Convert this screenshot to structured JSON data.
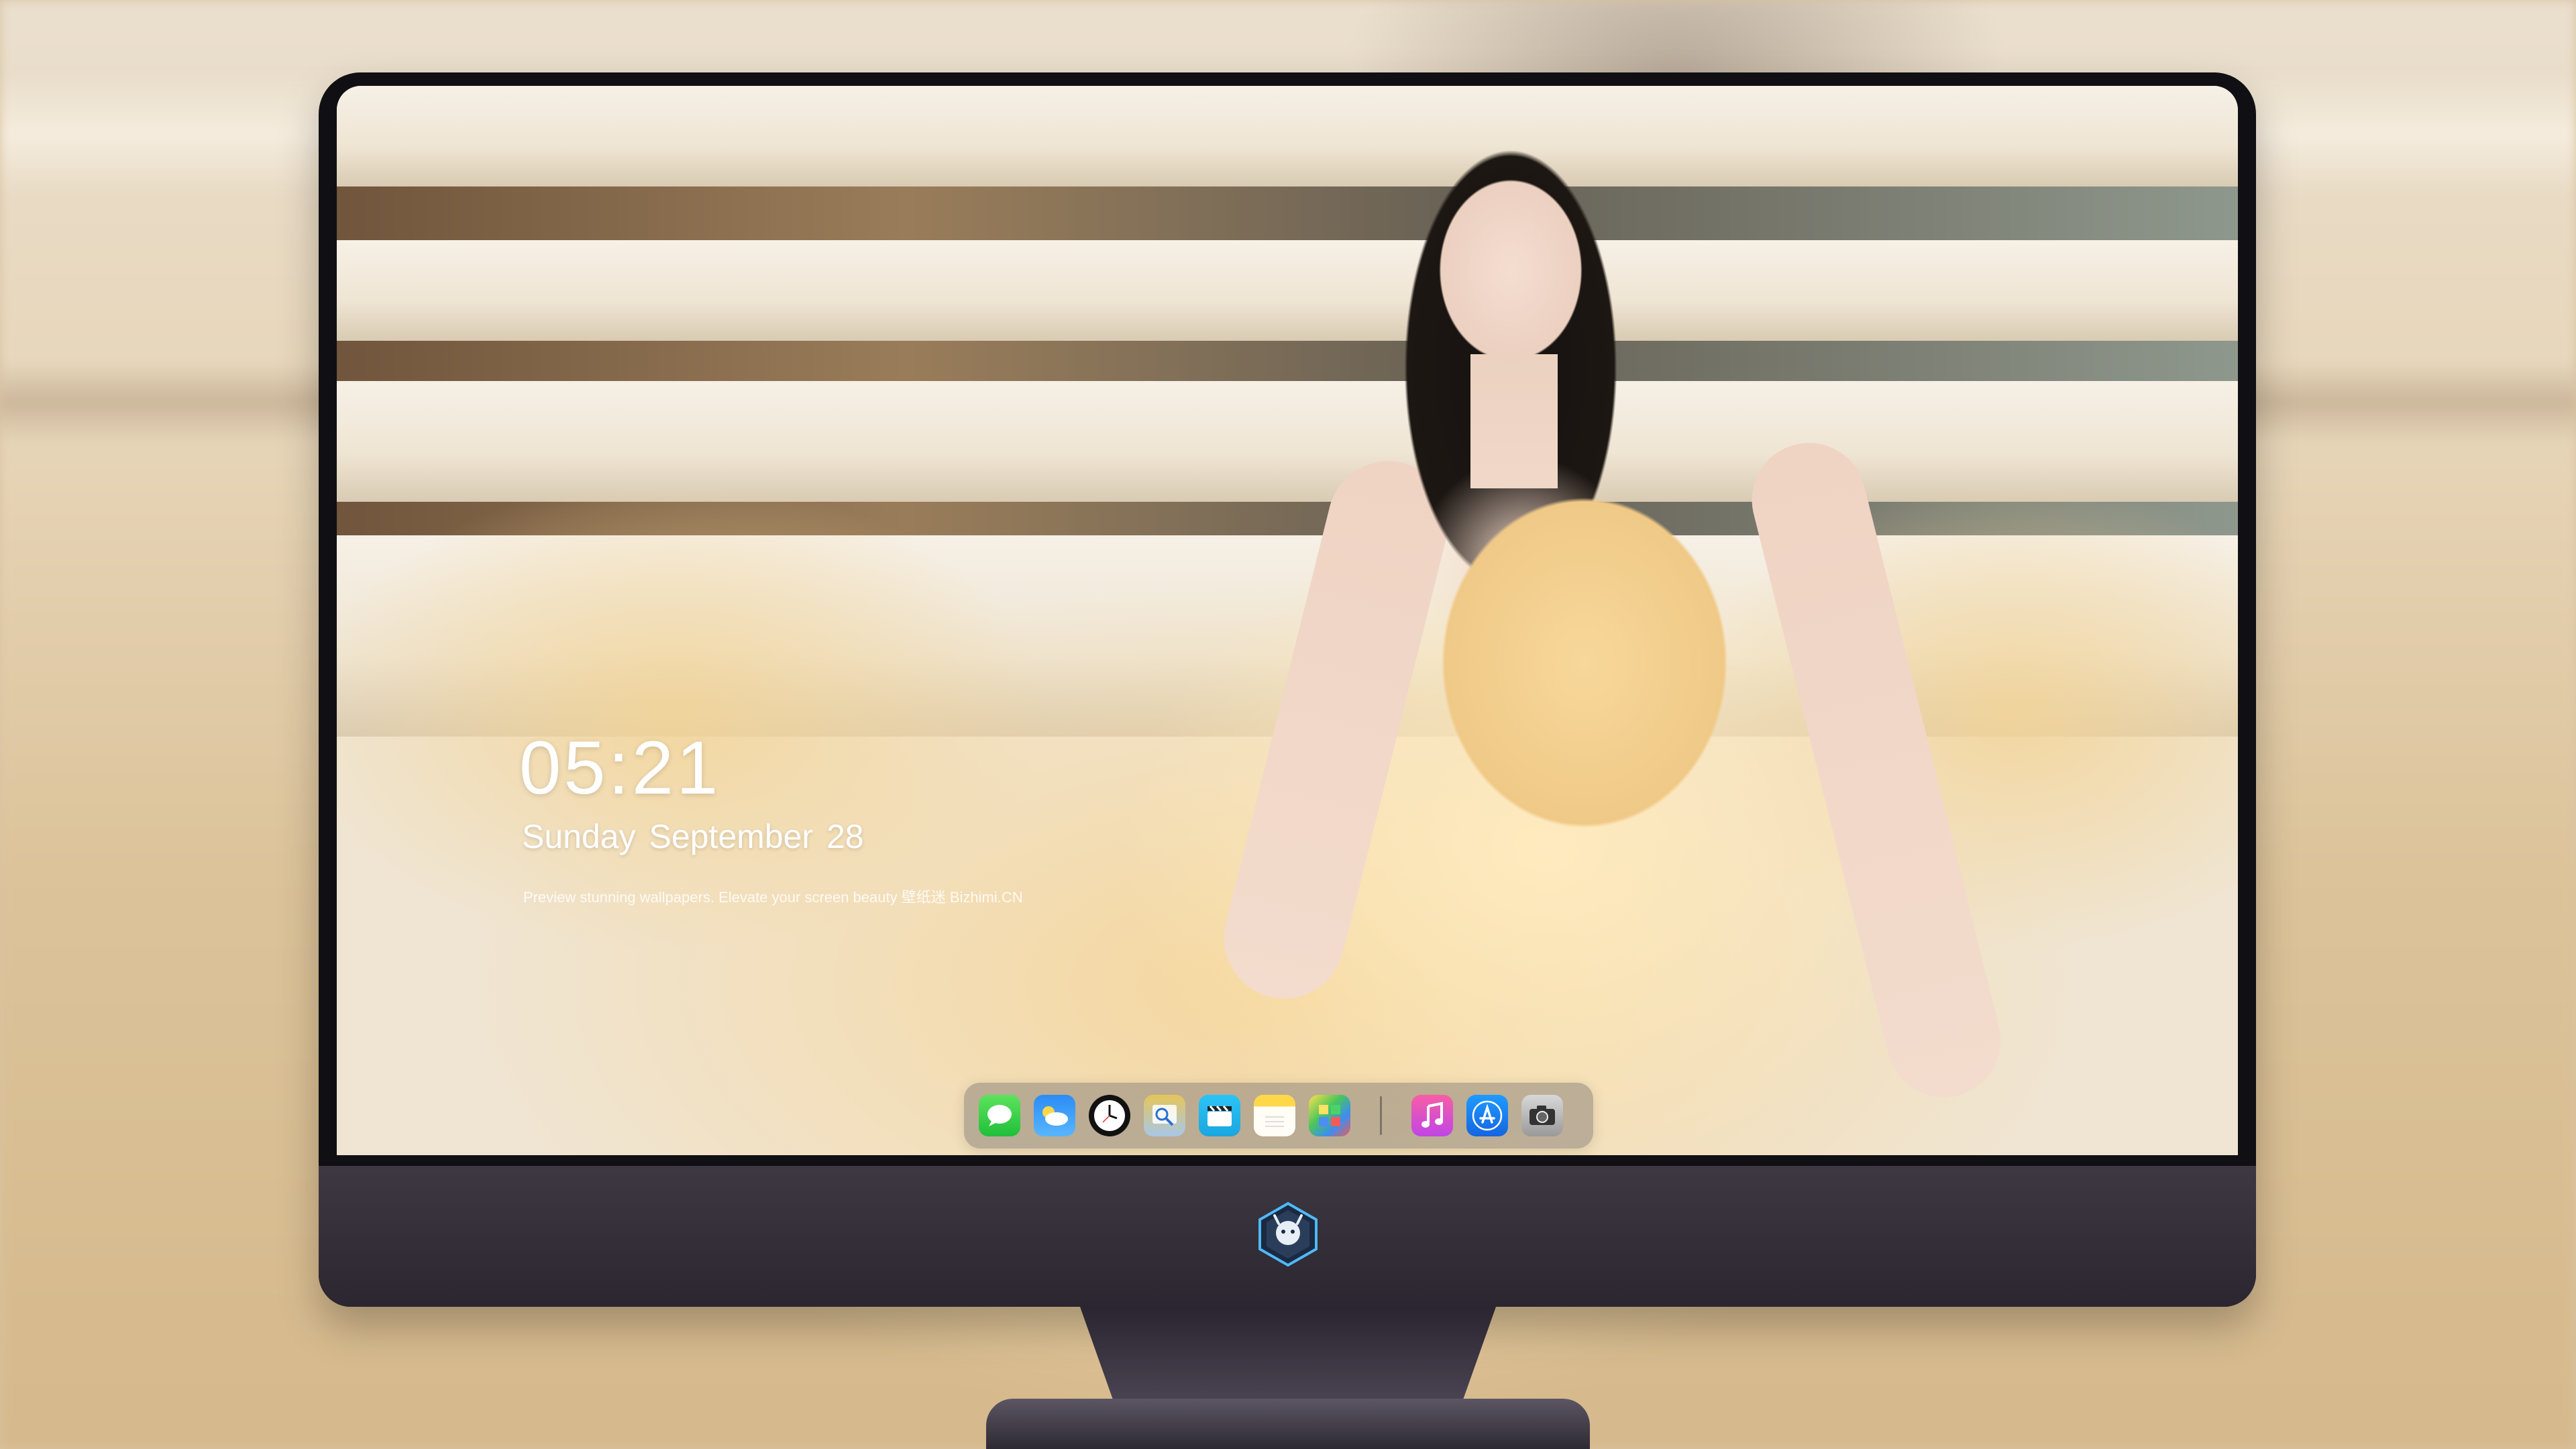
{
  "lock_widget": {
    "time": "05:21",
    "date": "Sunday September  28",
    "tagline": "Preview stunning wallpapers. Elevate your screen beauty  壁纸迷  Bizhimi.CN"
  },
  "dock": {
    "apps": [
      {
        "name": "Messages",
        "icon": "message-bubble-icon"
      },
      {
        "name": "Weather",
        "icon": "cloud-icon"
      },
      {
        "name": "Clock",
        "icon": "clock-icon"
      },
      {
        "name": "Preview",
        "icon": "preview-icon"
      },
      {
        "name": "Clips",
        "icon": "clapperboard-icon"
      },
      {
        "name": "Notes",
        "icon": "notes-icon"
      },
      {
        "name": "Photos",
        "icon": "photos-icon"
      },
      {
        "name": "Music",
        "icon": "music-note-icon"
      },
      {
        "name": "App Store",
        "icon": "app-store-icon"
      },
      {
        "name": "Camera",
        "icon": "camera-icon"
      }
    ]
  },
  "colors": {
    "bezel": "#101014",
    "chin": "#3e3842",
    "dock_bg": "rgba(110,105,105,0.42)",
    "clock_text": "#ffffff"
  }
}
